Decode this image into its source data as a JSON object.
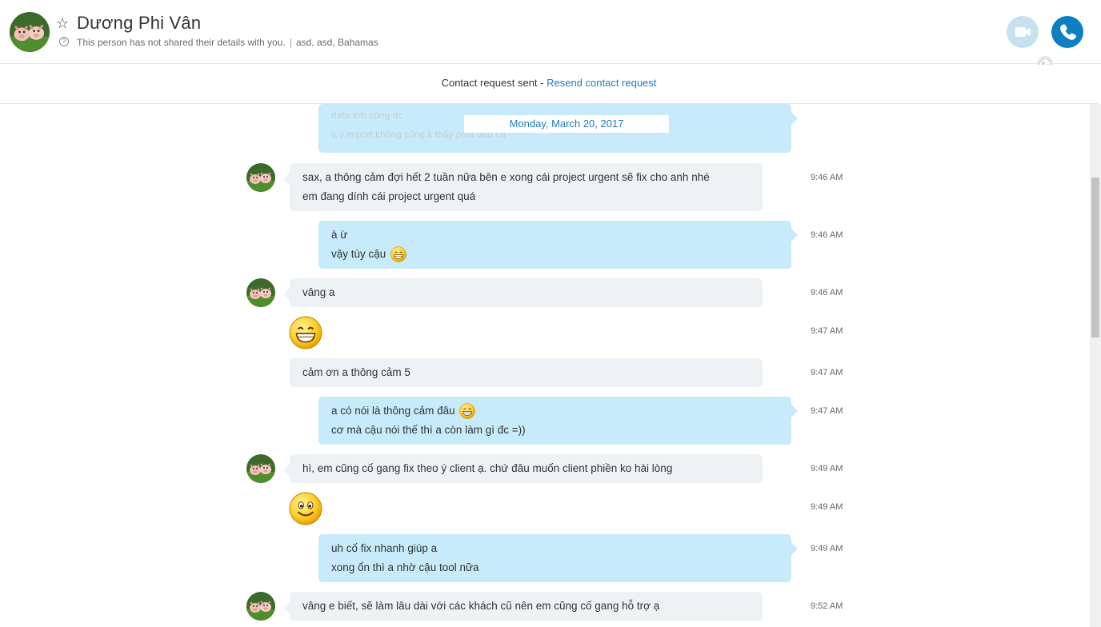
{
  "header": {
    "contact_name": "Dương Phi Vân",
    "details_notice": "This person has not shared their details with you.",
    "location": "asd, asd, Bahamas",
    "video_call_icon": "video-camera-icon",
    "voice_call_icon": "phone-icon",
    "status_icon": "globe-icon"
  },
  "request_bar": {
    "sent_text": "Contact request sent - ",
    "resend_link": "Resend contact request"
  },
  "date_separator": "Monday, March 20, 2017",
  "ghost_lines": [
    "data lớn cũng dc",
    "v. / import không cũng k thấy post đâu cả"
  ],
  "messages": [
    {
      "dir": "in",
      "lines": [
        "sax, a thông cảm đợi hết 2 tuần nữa bên e xong cái project urgent sẽ fix cho anh nhé",
        "em đang dính cái project urgent quá"
      ],
      "time": "9:46 AM"
    },
    {
      "dir": "out",
      "lines": [
        "à ừ",
        "vậy tùy cậu"
      ],
      "time": "9:46 AM"
    },
    {
      "dir": "in",
      "lines": [
        "vâng a"
      ],
      "time": "9:46 AM"
    },
    {
      "dir": "in",
      "emoji": "grin-emoji",
      "time": "9:47 AM"
    },
    {
      "dir": "in",
      "lines": [
        "cảm ơn a thông cảm 5"
      ],
      "time": "9:47 AM"
    },
    {
      "dir": "out",
      "lines": [
        "a có nói là thông cảm đâu",
        "cơ mà cậu nói thế thì a còn làm gì đc =))"
      ],
      "time": "9:47 AM"
    },
    {
      "dir": "in",
      "lines": [
        "hì, em cũng cố gang fix theo ý client ạ. chứ đâu muốn client phiền ko hài lòng"
      ],
      "time": "9:49 AM"
    },
    {
      "dir": "in",
      "emoji": "smile-emoji",
      "time": "9:49 AM"
    },
    {
      "dir": "out",
      "lines": [
        "uh cố fix nhanh giúp a",
        "xong ổn thì a nhờ cậu tool nữa"
      ],
      "time": "9:49 AM"
    },
    {
      "dir": "in",
      "lines": [
        "vâng e biết, sẽ làm lâu dài với các khách cũ nên em cũng cố gang hỗ trợ ạ"
      ],
      "time": "9:52 AM"
    }
  ],
  "colors": {
    "accent": "#1f7dbf",
    "incoming_bubble": "#eff2f5",
    "outgoing_bubble": "#c7ebfa",
    "call_button": "#0e7fc1",
    "video_button": "#c6e2f1"
  }
}
